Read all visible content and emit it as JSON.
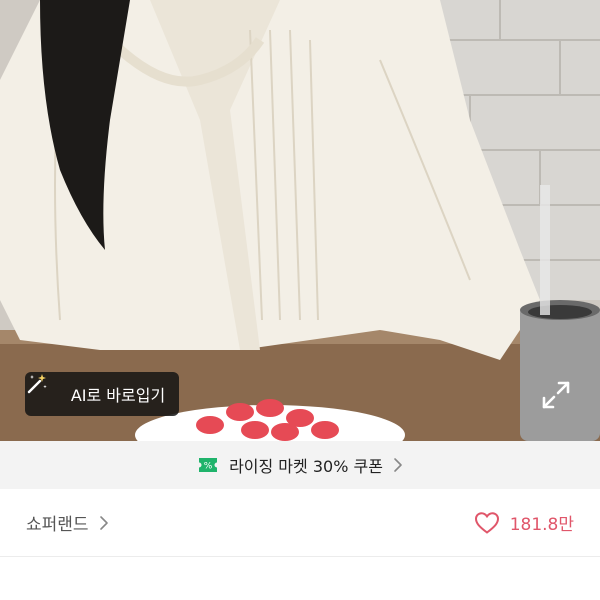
{
  "product": {
    "image_alt": "",
    "ai_try_on_label": "AI로 바로입기",
    "ai_icon": "magic-wand-icon",
    "expand_icon": "expand-icon"
  },
  "coupon": {
    "icon": "discount-coupon-icon",
    "label": "라이징 마켓 30% 쿠폰",
    "accent_color": "#1fb36b"
  },
  "seller": {
    "name": "쇼퍼랜드",
    "like_icon": "heart-outline-icon",
    "like_count": "181.8만",
    "like_color": "#e0566a"
  }
}
